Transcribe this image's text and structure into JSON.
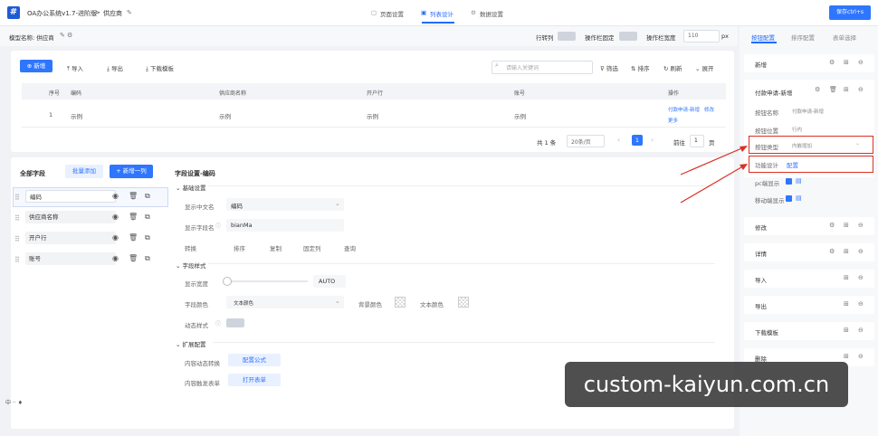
{
  "header": {
    "app_name": "OA办公系统v1.7-进阶版",
    "sep": ">",
    "page": "供应商",
    "nav": [
      "页面设置",
      "列表设计",
      "数据设置"
    ],
    "save": "保存ctrl+s"
  },
  "model": {
    "label": "模型名称: 供应商",
    "opts": [
      "行转列",
      "操作栏固定",
      "操作栏宽度"
    ],
    "width_value": "110",
    "unit": "px"
  },
  "toolbar": {
    "new": "新增",
    "import": "导入",
    "export": "导出",
    "download": "下载模板",
    "search_placeholder": "请输入关键词",
    "filter": "筛选",
    "sort": "排序",
    "refresh": "刷新",
    "expand": "展开"
  },
  "table": {
    "headers": [
      "序号",
      "编码",
      "供应商名称",
      "开户行",
      "账号",
      "操作"
    ],
    "row": [
      "1",
      "示例",
      "示例",
      "示例",
      "示例"
    ],
    "ops": [
      "付款申请-新增",
      "修改",
      "更多"
    ]
  },
  "pagination": {
    "total": "共 1 条",
    "size": "20条/页",
    "page": "1",
    "goto": "前往",
    "goto_page": "1",
    "suffix": "页"
  },
  "fields": {
    "title": "全部字段",
    "batch": "批量添加",
    "add": "+ 新增一列",
    "items": [
      "编码",
      "供应商名称",
      "开户行",
      "账号"
    ]
  },
  "settings": {
    "title": "字段设置-编码",
    "basic": "基础设置",
    "cn_name_label": "显示中文名",
    "cn_name": "编码",
    "field_name_label": "显示字段名",
    "field_name": "bianMa",
    "convert_label": "转换",
    "convert_opts": [
      "排序",
      "复制",
      "固定列",
      "查询"
    ],
    "style": "字段样式",
    "width_label": "显示宽度",
    "width_value": "AUTO",
    "color_label": "字段颜色",
    "color_value": "文本颜色",
    "bg_label": "背景颜色",
    "text_label": "文本颜色",
    "dynamic_label": "动态样式",
    "ext": "扩展配置",
    "content_label": "内容动态转换",
    "content_btn": "配置公式",
    "trigger_label": "内容触发表单",
    "trigger_btn": "打开表单"
  },
  "right": {
    "tabs": [
      "按钮配置",
      "排序配置",
      "表单选择"
    ],
    "new_btn": "新增",
    "pay_new": "付款申请-新增",
    "btn_name_label": "按钮名称",
    "btn_name": "付款申请-新增",
    "btn_pos_label": "按钮位置",
    "btn_pos": "行内",
    "btn_type_label": "按钮类型",
    "btn_type": "内嵌增加",
    "design_label": "功能设计",
    "design_link": "配置",
    "pc_label": "pc端显示",
    "mobile_label": "移动端显示",
    "items": [
      "修改",
      "详情",
      "导入",
      "导出",
      "下载模板",
      "删除"
    ]
  },
  "watermark": "custom-kaiyun.com.cn",
  "footer_icons": "中 ·· ♦"
}
